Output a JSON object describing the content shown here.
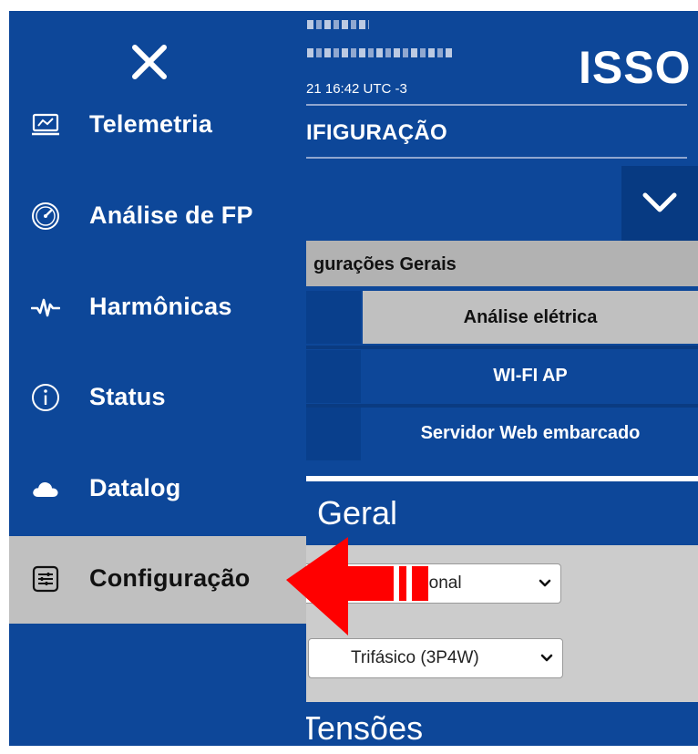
{
  "header": {
    "datetime": "21 16:42 UTC -3",
    "logo": "ISSO"
  },
  "page": {
    "title": "IFIGURAÇÃO"
  },
  "section": {
    "label": "gurações Gerais"
  },
  "subnav": {
    "items": [
      {
        "label": "Análise elétrica",
        "selected": true
      },
      {
        "label": "WI-FI AP",
        "selected": false
      },
      {
        "label": "Servidor Web embarcado",
        "selected": false
      }
    ]
  },
  "geral": {
    "title": "Geral",
    "direction_select": "idirecional",
    "system_select": "Trifásico (3P4W)"
  },
  "tensoes": {
    "title": "Tensões"
  },
  "drawer": {
    "close_icon": "close-icon",
    "items": [
      {
        "label": "Telemetria",
        "icon": "monitor-chart-icon"
      },
      {
        "label": "Análise de FP",
        "icon": "gauge-icon"
      },
      {
        "label": "Harmônicas",
        "icon": "waveform-icon"
      },
      {
        "label": "Status",
        "icon": "info-icon"
      },
      {
        "label": "Datalog",
        "icon": "cloud-icon"
      },
      {
        "label": "Configuração",
        "icon": "settings-sliders-icon",
        "active": true
      }
    ]
  },
  "colors": {
    "primary_blue": "#0d4799",
    "active_gray": "#c0c0c0",
    "annotation_red": "#ff0000"
  }
}
